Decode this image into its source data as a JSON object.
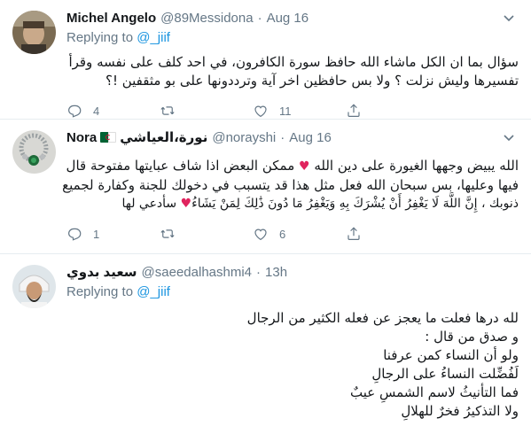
{
  "tweets": [
    {
      "display_name": "Michel Angelo",
      "handle": "@89Messidona",
      "dot": "·",
      "time": "Aug 16",
      "replying_prefix": "Replying to",
      "replying_mention": "@_jiif",
      "text_lines": [
        "سؤال بما ان الكل ماشاء الله حافظ سورة الكافرون، في احد كلف على نفسه وقرأ",
        "تفسيرها وليش نزلت ؟ ولا بس حافظين اخر آية وترددونها على بو مثقفين !؟"
      ],
      "counts": {
        "reply": "4",
        "retweet": "",
        "like": "11",
        "share": ""
      }
    },
    {
      "display_name": "Nora",
      "display_name_ar": "نورة،العياشي",
      "handle": "@norayshi",
      "dot": "·",
      "time": "Aug 16",
      "text_lines": [
        "الله يبيض وجهها الغيورة على دين الله ♥ ممكن البعض اذا شاف عبايتها مفتوحة قال",
        "فيها وعليها، بس سبحان الله فعل مثل هذا قد يتسبب في دخولك للجنة وكفارة لجميع",
        "ذنوبك ، إِنَّ اللَّهَ لَا يَغْفِرُ أَنْ يُشْرَكَ بِهِ وَيَغْفِرُ مَا دُونَ ذَٰلِكَ لِمَنْ يَشَاءُ♥ سأدعي لها"
      ],
      "counts": {
        "reply": "1",
        "retweet": "",
        "like": "6",
        "share": ""
      }
    },
    {
      "display_name": "سعيد بدوي",
      "handle": "@saeedalhashmi4",
      "dot": "·",
      "time": "13h",
      "replying_prefix": "Replying to",
      "replying_mention": "@_jiif",
      "text_lines": [
        "لله درها فعلت ما يعجز عن فعله الكثير من الرجال",
        "و صدق من قال :",
        "ولو أن النساء كمن عرفنا",
        "لَفُضِّلت النساءُ على الرجالِ",
        "فما التأنيثُ لاسم الشمسِ عيبٌ",
        "ولا التذكيرُ فخرٌ للهلالِ"
      ],
      "counts": {
        "reply": "",
        "retweet": "",
        "like": "",
        "share": ""
      }
    }
  ],
  "colors": {
    "name": "#14171a",
    "meta": "#657786",
    "link": "#1b95e0",
    "divider": "#e6ecf0",
    "heart": "#e0245e"
  },
  "icons": [
    "reply-icon",
    "retweet-icon",
    "like-icon",
    "share-icon",
    "caret-down-icon"
  ]
}
